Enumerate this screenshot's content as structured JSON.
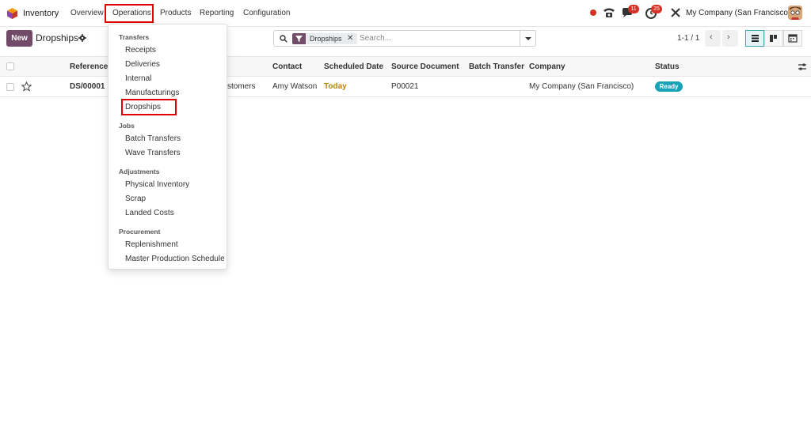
{
  "navbar": {
    "app_name": "Inventory",
    "menu": [
      "Overview",
      "Operations",
      "Products",
      "Reporting",
      "Configuration"
    ],
    "active_menu": "Operations",
    "chat_badge": "11",
    "activity_badge": "25",
    "company": "My Company (San Francisco)"
  },
  "control_panel": {
    "new_label": "New",
    "title": "Dropships",
    "facet_label": "Dropships",
    "search_placeholder": "Search...",
    "pager": "1-1 / 1"
  },
  "table": {
    "columns": [
      "Reference",
      "Contact",
      "Scheduled Date",
      "Source Document",
      "Batch Transfer",
      "Company",
      "Status"
    ],
    "rows": [
      {
        "reference": "DS/00001",
        "from_partial": "stomers",
        "contact": "Amy Watson",
        "scheduled_date": "Today",
        "source_document": "P00021",
        "batch_transfer": "",
        "company": "My Company (San Francisco)",
        "status": "Ready"
      }
    ]
  },
  "dropdown": {
    "sections": [
      {
        "title": "Transfers",
        "items": [
          "Receipts",
          "Deliveries",
          "Internal",
          "Manufacturings",
          "Dropships"
        ]
      },
      {
        "title": "Jobs",
        "items": [
          "Batch Transfers",
          "Wave Transfers"
        ]
      },
      {
        "title": "Adjustments",
        "items": [
          "Physical Inventory",
          "Scrap",
          "Landed Costs"
        ]
      },
      {
        "title": "Procurement",
        "items": [
          "Replenishment",
          "Master Production Schedule"
        ]
      }
    ],
    "highlighted_item": "Dropships"
  },
  "colors": {
    "brand": "#714b67",
    "status_ready": "#17a2b8",
    "badge": "#d93025",
    "highlight_box": "#e00000",
    "today": "#b8860b"
  }
}
